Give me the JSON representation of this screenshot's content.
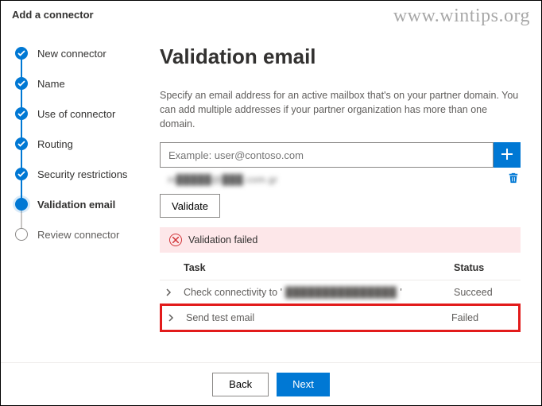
{
  "window_title": "Add a connector",
  "watermark": "www.wintips.org",
  "steps": [
    {
      "label": "New connector",
      "state": "done"
    },
    {
      "label": "Name",
      "state": "done"
    },
    {
      "label": "Use of connector",
      "state": "done"
    },
    {
      "label": "Routing",
      "state": "done"
    },
    {
      "label": "Security restrictions",
      "state": "done"
    },
    {
      "label": "Validation email",
      "state": "current"
    },
    {
      "label": "Review connector",
      "state": "future"
    }
  ],
  "main": {
    "heading": "Validation email",
    "description": "Specify an email address for an active mailbox that's on your partner domain. You can add multiple addresses if your partner organization has more than one domain.",
    "input_placeholder": "Example: user@contoso.com",
    "listed_email_blurred": "m█████@███.com.gr",
    "validate_label": "Validate"
  },
  "validation": {
    "banner_text": "Validation failed",
    "columns": {
      "task": "Task",
      "status": "Status"
    },
    "rows": [
      {
        "task_prefix": "Check connectivity to '",
        "task_blurred": "███████████████",
        "task_suffix": "'",
        "status": "Succeed"
      },
      {
        "task_prefix": "Send test email",
        "task_blurred": "",
        "task_suffix": "",
        "status": "Failed"
      }
    ]
  },
  "footer": {
    "back": "Back",
    "next": "Next"
  }
}
